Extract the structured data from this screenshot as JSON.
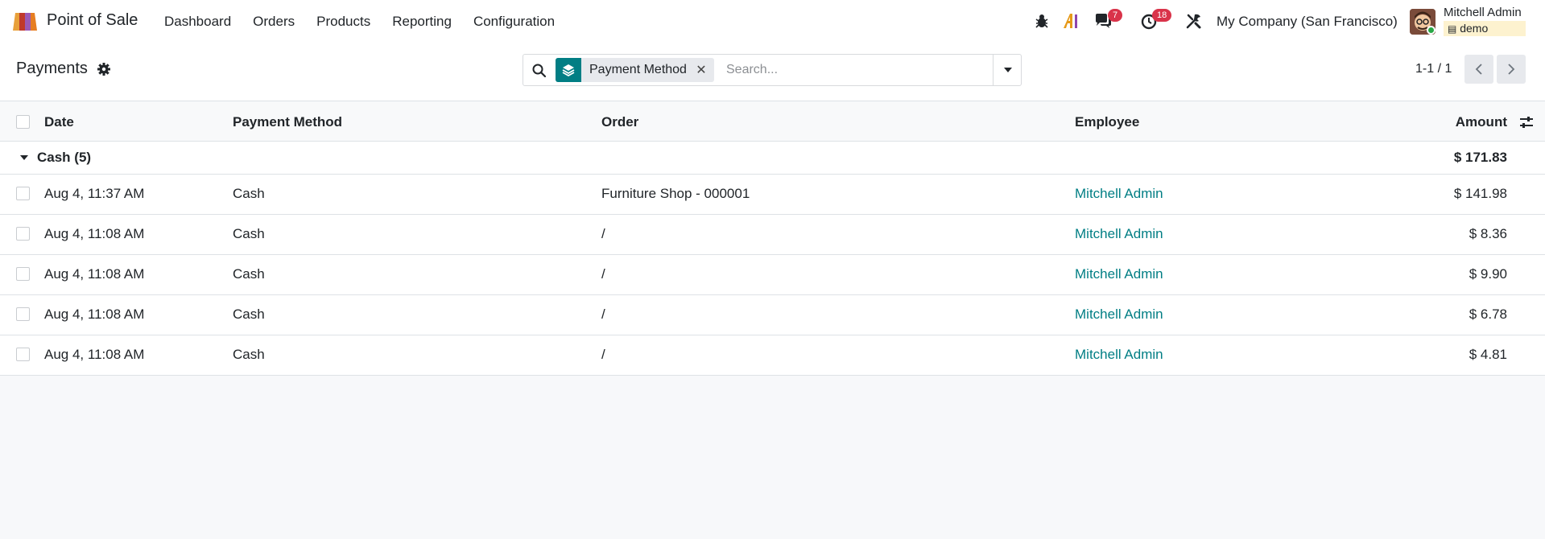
{
  "navbar": {
    "app_name": "Point of Sale",
    "menu": [
      "Dashboard",
      "Orders",
      "Products",
      "Reporting",
      "Configuration"
    ],
    "messages_count": "7",
    "activities_count": "18",
    "company": "My Company (San Francisco)",
    "user_name": "Mitchell Admin",
    "database": "demo"
  },
  "control_panel": {
    "title": "Payments",
    "search": {
      "facet_label": "Payment Method",
      "placeholder": "Search..."
    },
    "pager": "1-1 / 1"
  },
  "table": {
    "columns": [
      "Date",
      "Payment Method",
      "Order",
      "Employee",
      "Amount"
    ],
    "group": {
      "label": "Cash (5)",
      "total": "$ 171.83"
    },
    "rows": [
      {
        "date": "Aug 4, 11:37 AM",
        "method": "Cash",
        "order": "Furniture Shop - 000001",
        "employee": "Mitchell Admin",
        "amount": "$ 141.98"
      },
      {
        "date": "Aug 4, 11:08 AM",
        "method": "Cash",
        "order": "/",
        "employee": "Mitchell Admin",
        "amount": "$ 8.36"
      },
      {
        "date": "Aug 4, 11:08 AM",
        "method": "Cash",
        "order": "/",
        "employee": "Mitchell Admin",
        "amount": "$ 9.90"
      },
      {
        "date": "Aug 4, 11:08 AM",
        "method": "Cash",
        "order": "/",
        "employee": "Mitchell Admin",
        "amount": "$ 6.78"
      },
      {
        "date": "Aug 4, 11:08 AM",
        "method": "Cash",
        "order": "/",
        "employee": "Mitchell Admin",
        "amount": "$ 4.81"
      }
    ]
  },
  "colors": {
    "accent": "#017e84",
    "badge": "#d9334a",
    "background": "#f7f8fa"
  }
}
